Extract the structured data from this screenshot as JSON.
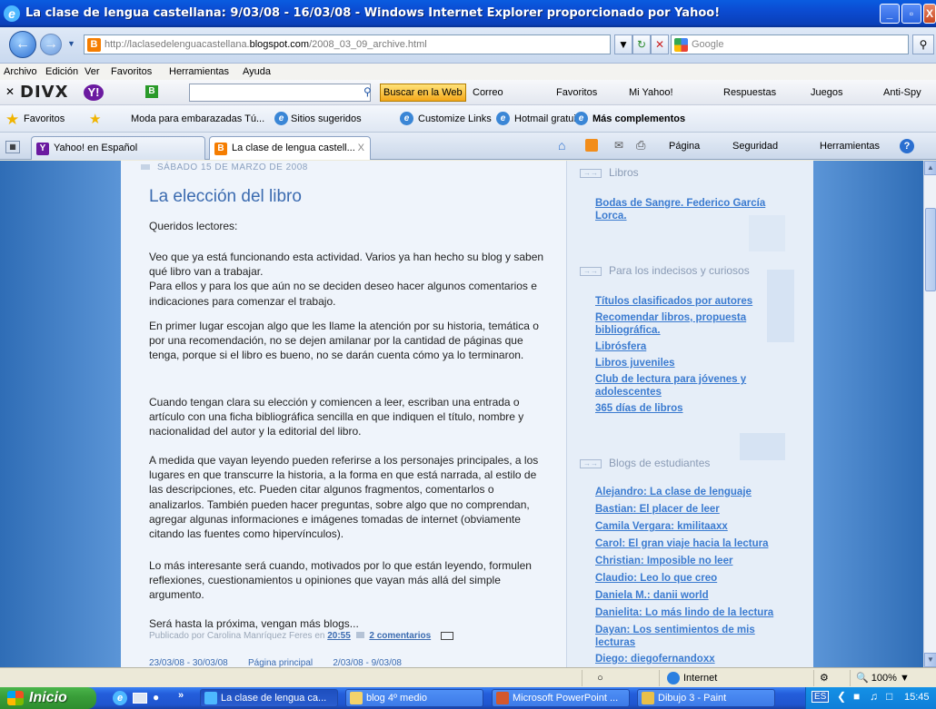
{
  "window": {
    "title": "La clase de lengua castellana: 9/03/08 - 16/03/08 - Windows Internet Explorer proporcionado por Yahoo!",
    "min_label": "_",
    "max_label": "▫",
    "close_label": "X"
  },
  "address": {
    "url_prefix": "http://laclasedelenguacastellana.",
    "url_domain": "blogspot.com",
    "url_path": "/2008_03_09_archive.html",
    "search_placeholder": "Google"
  },
  "menu": [
    "Archivo",
    "Edición",
    "Ver",
    "Favoritos",
    "Herramientas",
    "Ayuda"
  ],
  "toolbar1": {
    "divx": "DIVX",
    "web_button": "Buscar en la Web",
    "items": [
      "Correo",
      "Favoritos",
      "Mi Yahoo!",
      "Respuestas",
      "Juegos",
      "Anti-Spy"
    ]
  },
  "favbar": {
    "favorites": "Favoritos",
    "links": [
      "Moda para embarazadas Tú...",
      "Sitios sugeridos",
      "Customize Links",
      "Hotmail gratuito",
      "Más complementos"
    ]
  },
  "tabs": [
    {
      "label": "Yahoo! en Español"
    },
    {
      "label": "La clase de lengua castell...",
      "close": "X"
    }
  ],
  "commandbar": [
    "Página",
    "Seguridad",
    "Herramientas"
  ],
  "post": {
    "date": "SÁBADO 15 DE MARZO DE 2008",
    "title": "La elección del libro",
    "paragraphs": [
      "Queridos lectores:",
      "Veo que ya está funcionando esta actividad. Varios ya han hecho su blog y saben qué libro van a trabajar.\nPara ellos y para los que aún no se deciden deseo hacer algunos comentarios e indicaciones para comenzar el trabajo.",
      "En primer lugar escojan algo que les llame la atención por su historia, temática o por una recomendación, no se dejen amilanar por la cantidad de páginas que tenga, porque si el libro es bueno, no se darán cuenta cómo ya lo terminaron.",
      "Cuando tengan clara su elección y comiencen a leer, escriban una entrada o artículo con una ficha bibliográfica sencilla en que indiquen el título, nombre y nacionalidad del autor y la editorial del libro.",
      "A medida que vayan leyendo pueden referirse a los personajes principales, a los lugares en que transcurre la historia, a la forma en que está narrada, al estilo de las descripciones, etc. Pueden citar algunos fragmentos, comentarlos o analizarlos. También pueden hacer preguntas, sobre algo que no comprendan, agregar algunas informaciones e imágenes tomadas de internet (obviamente citando las fuentes como hipervínculos).",
      "Lo más interesante será cuando, motivados por lo que están leyendo, formulen reflexiones, cuestionamientos u opiniones que vayan más allá del simple argumento.",
      "Será hasta la próxima, vengan más blogs..."
    ],
    "footer_prefix": "Publicado por Carolina Manríquez Feres en",
    "footer_time": "20:55",
    "footer_comments": "2 comentarios",
    "nav_text": "23/03/08 - 30/03/08        Página principal        2/03/08 - 9/03/08"
  },
  "sidebar": {
    "sections": [
      {
        "heading": "Libros",
        "links": [
          "Bodas de Sangre. Federico García Lorca."
        ]
      },
      {
        "heading": "Para los indecisos y curiosos",
        "links": [
          "Títulos clasificados por autores",
          "Recomendar libros, propuesta bibliográfica.",
          "Librósfera",
          "Libros juveniles",
          "Club de lectura para jóvenes y adolescentes",
          "365 días de libros"
        ]
      },
      {
        "heading": "Blogs de estudiantes",
        "links": [
          "Alejandro: La clase de lenguaje",
          "Bastian: El placer de leer",
          "Camila Vergara: kmilitaaxx",
          "Carol: El gran viaje hacia la lectura",
          "Christian: Imposible no leer",
          "Claudio: Leo lo que creo",
          "Daniela M.: danii world",
          "Danielita: Lo más lindo de la lectura",
          "Dayan: Los sentimientos de mis lecturas",
          "Diego: diegofernandoxx"
        ]
      }
    ]
  },
  "statusbar": {
    "zone": "Internet",
    "zoom": "100%"
  },
  "taskbar": {
    "start": "Inicio",
    "tasks": [
      "La clase de lengua ca...",
      "blog 4º medio",
      "Microsoft PowerPoint ...",
      "Dibujo 3 - Paint"
    ],
    "lang": "ES",
    "time": "15:45"
  },
  "colors": {
    "accent": "#3b6bb0",
    "link": "#3b7bd0",
    "bg_blue": "#4a86ca"
  }
}
